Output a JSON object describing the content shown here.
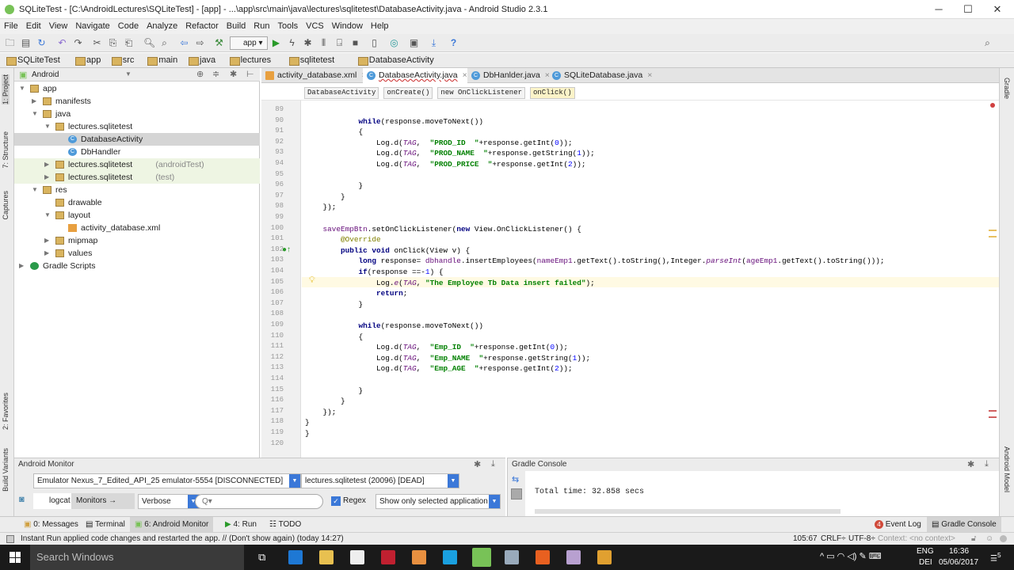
{
  "window": {
    "title": "SQLiteTest - [C:\\AndroidLectures\\SQLiteTest] - [app] - ...\\app\\src\\main\\java\\lectures\\sqlitetest\\DatabaseActivity.java - Android Studio 2.3.1",
    "minimize": "─",
    "maximize": "☐",
    "close": "✕"
  },
  "menu": [
    "File",
    "Edit",
    "View",
    "Navigate",
    "Code",
    "Analyze",
    "Refactor",
    "Build",
    "Run",
    "Tools",
    "VCS",
    "Window",
    "Help"
  ],
  "toolbar": {
    "run_config": "app",
    "help": "?"
  },
  "breadcrumb": [
    "SQLiteTest",
    "app",
    "src",
    "main",
    "java",
    "lectures",
    "sqlitetest",
    "DatabaseActivity"
  ],
  "left_strip": [
    "1: Project",
    "7: Structure",
    "Captures",
    "2: Favorites",
    "Build Variants"
  ],
  "right_strip": [
    "Gradle",
    "Android Model"
  ],
  "project": {
    "view": "Android",
    "tree": [
      {
        "label": "app",
        "sub": "",
        "level": 0,
        "icon": "folder",
        "arrow": "▼"
      },
      {
        "label": "manifests",
        "sub": "",
        "level": 1,
        "icon": "folder",
        "arrow": "▶"
      },
      {
        "label": "java",
        "sub": "",
        "level": 1,
        "icon": "folder",
        "arrow": "▼"
      },
      {
        "label": "lectures.sqlitetest",
        "sub": "",
        "level": 2,
        "icon": "folder",
        "arrow": "▼"
      },
      {
        "label": "DatabaseActivity",
        "sub": "",
        "level": 3,
        "icon": "class",
        "arrow": "",
        "selected": true
      },
      {
        "label": "DbHandler",
        "sub": "",
        "level": 3,
        "icon": "class",
        "arrow": ""
      },
      {
        "label": "lectures.sqlitetest",
        "sub": "(androidTest)",
        "level": 2,
        "icon": "folder",
        "arrow": "▶",
        "tint": true
      },
      {
        "label": "lectures.sqlitetest",
        "sub": "(test)",
        "level": 2,
        "icon": "folder",
        "arrow": "▶",
        "tint": true
      },
      {
        "label": "res",
        "sub": "",
        "level": 1,
        "icon": "folder",
        "arrow": "▼"
      },
      {
        "label": "drawable",
        "sub": "",
        "level": 2,
        "icon": "folder",
        "arrow": ""
      },
      {
        "label": "layout",
        "sub": "",
        "level": 2,
        "icon": "folder",
        "arrow": "▼"
      },
      {
        "label": "activity_database.xml",
        "sub": "",
        "level": 3,
        "icon": "xml",
        "arrow": ""
      },
      {
        "label": "mipmap",
        "sub": "",
        "level": 2,
        "icon": "folder",
        "arrow": "▶"
      },
      {
        "label": "values",
        "sub": "",
        "level": 2,
        "icon": "folder",
        "arrow": "▶"
      },
      {
        "label": "Gradle Scripts",
        "sub": "",
        "level": 0,
        "icon": "gradle",
        "arrow": "▶"
      }
    ]
  },
  "tabs": [
    {
      "label": "activity_database.xml",
      "active": false
    },
    {
      "label": "DatabaseActivity.java",
      "active": true
    },
    {
      "label": "DbHanlder.java",
      "active": false
    },
    {
      "label": "SQLiteDatabase.java",
      "active": false
    }
  ],
  "editor_breadcrumb": [
    "DatabaseActivity",
    "onCreate()",
    "new OnClickListener",
    "onClick()"
  ],
  "code": {
    "first_line": 89,
    "current_line": 105,
    "lines": [
      [],
      [
        [
          "            ",
          ""
        ],
        [
          "while",
          "kw"
        ],
        [
          "(response.moveToNext())",
          ""
        ]
      ],
      [
        [
          "            {",
          ""
        ]
      ],
      [
        [
          "                Log.d(",
          ""
        ],
        [
          "TAG",
          "it"
        ],
        [
          ",  ",
          ""
        ],
        [
          "\"PROD_ID  \"",
          "st"
        ],
        [
          "+response.getInt(",
          ""
        ],
        [
          "0",
          "nm"
        ],
        [
          "));",
          ""
        ]
      ],
      [
        [
          "                Log.d(",
          ""
        ],
        [
          "TAG",
          "it"
        ],
        [
          ",  ",
          ""
        ],
        [
          "\"PROD_NAME  \"",
          "st"
        ],
        [
          "+response.getString(",
          ""
        ],
        [
          "1",
          "nm"
        ],
        [
          "));",
          ""
        ]
      ],
      [
        [
          "                Log.d(",
          ""
        ],
        [
          "TAG",
          "it"
        ],
        [
          ",  ",
          ""
        ],
        [
          "\"PROD_PRICE  \"",
          "st"
        ],
        [
          "+response.getInt(",
          ""
        ],
        [
          "2",
          "nm"
        ],
        [
          "));",
          ""
        ]
      ],
      [],
      [
        [
          "            }",
          ""
        ]
      ],
      [
        [
          "        }",
          ""
        ]
      ],
      [
        [
          "    });",
          ""
        ]
      ],
      [],
      [
        [
          "    ",
          ""
        ],
        [
          "saveEmpBtn",
          "fd"
        ],
        [
          ".setOnClickListener(",
          ""
        ],
        [
          "new",
          "kw"
        ],
        [
          " View.OnClickListener() {",
          ""
        ]
      ],
      [
        [
          "        ",
          ""
        ],
        [
          "@Override",
          "an"
        ]
      ],
      [
        [
          "        ",
          ""
        ],
        [
          "public void",
          "kw"
        ],
        [
          " onClick(View v) {",
          ""
        ]
      ],
      [
        [
          "            ",
          ""
        ],
        [
          "long",
          "kw"
        ],
        [
          " response= ",
          ""
        ],
        [
          "dbhandle",
          "fd"
        ],
        [
          ".insertEmployees(",
          ""
        ],
        [
          "nameEmp1",
          "fd"
        ],
        [
          ".getText().toString(),Integer.",
          ""
        ],
        [
          "parseInt",
          "it"
        ],
        [
          "(",
          ""
        ],
        [
          "ageEmp1",
          "fd"
        ],
        [
          ".getText().toString()));",
          ""
        ]
      ],
      [
        [
          "            ",
          ""
        ],
        [
          "if",
          "kw"
        ],
        [
          "(response ==-",
          ""
        ],
        [
          "1",
          "nm"
        ],
        [
          ") {",
          ""
        ]
      ],
      [
        [
          "                Log.",
          ""
        ],
        [
          "e",
          "it"
        ],
        [
          "(",
          ""
        ],
        [
          "TAG",
          "it"
        ],
        [
          ", ",
          ""
        ],
        [
          "\"The Employee Tb Data insert failed\"",
          "st"
        ],
        [
          ");",
          ""
        ]
      ],
      [
        [
          "                ",
          ""
        ],
        [
          "return",
          "kw"
        ],
        [
          ";",
          ""
        ]
      ],
      [
        [
          "            }",
          ""
        ]
      ],
      [],
      [
        [
          "            ",
          ""
        ],
        [
          "while",
          "kw"
        ],
        [
          "(response.moveToNext())",
          ""
        ]
      ],
      [
        [
          "            {",
          ""
        ]
      ],
      [
        [
          "                Log.d(",
          ""
        ],
        [
          "TAG",
          "it"
        ],
        [
          ",  ",
          ""
        ],
        [
          "\"Emp_ID  \"",
          "st"
        ],
        [
          "+response.getInt(",
          ""
        ],
        [
          "0",
          "nm"
        ],
        [
          "));",
          ""
        ]
      ],
      [
        [
          "                Log.d(",
          ""
        ],
        [
          "TAG",
          "it"
        ],
        [
          ",  ",
          ""
        ],
        [
          "\"Emp_NAME  \"",
          "st"
        ],
        [
          "+response.getString(",
          ""
        ],
        [
          "1",
          "nm"
        ],
        [
          "));",
          ""
        ]
      ],
      [
        [
          "                Log.d(",
          ""
        ],
        [
          "TAG",
          "it"
        ],
        [
          ",  ",
          ""
        ],
        [
          "\"Emp_AGE  \"",
          "st"
        ],
        [
          "+response.getInt(",
          ""
        ],
        [
          "2",
          "nm"
        ],
        [
          "));",
          ""
        ]
      ],
      [],
      [
        [
          "            }",
          ""
        ]
      ],
      [
        [
          "        }",
          ""
        ]
      ],
      [
        [
          "    });",
          ""
        ]
      ],
      [
        [
          "}",
          ""
        ]
      ],
      [
        [
          "}",
          ""
        ]
      ],
      []
    ]
  },
  "android_monitor": {
    "title": "Android Monitor",
    "device": "Emulator Nexus_7_Edited_API_25 emulator-5554 [DISCONNECTED]",
    "process": "lectures.sqlitetest (20096) [DEAD]",
    "tab_logcat": "logcat",
    "tab_monitors": "Monitors",
    "level": "Verbose",
    "search_placeholder": "Q▾",
    "regex_label": "Regex",
    "regex_checked": true,
    "filter": "Show only selected application"
  },
  "gradle_console": {
    "title": "Gradle Console",
    "output": "Total time: 32.858 secs"
  },
  "tool_windows": [
    "0: Messages",
    "Terminal",
    "6: Android Monitor",
    "4: Run",
    "TODO"
  ],
  "tool_windows_right": {
    "event_log": "Event Log",
    "event_count": "4",
    "gradle_console": "Gradle Console"
  },
  "status": {
    "message": "Instant Run applied code changes and restarted the app. // (Don't show again) (today 14:27)",
    "position": "105:67",
    "line_sep": "CRLF÷",
    "encoding": "UTF-8÷",
    "context": "Context: <no context>"
  },
  "taskbar": {
    "search": "Search Windows",
    "lang1": "ENG",
    "lang2": "DEI",
    "time": "16:36",
    "date": "05/06/2017",
    "notif": "5"
  }
}
